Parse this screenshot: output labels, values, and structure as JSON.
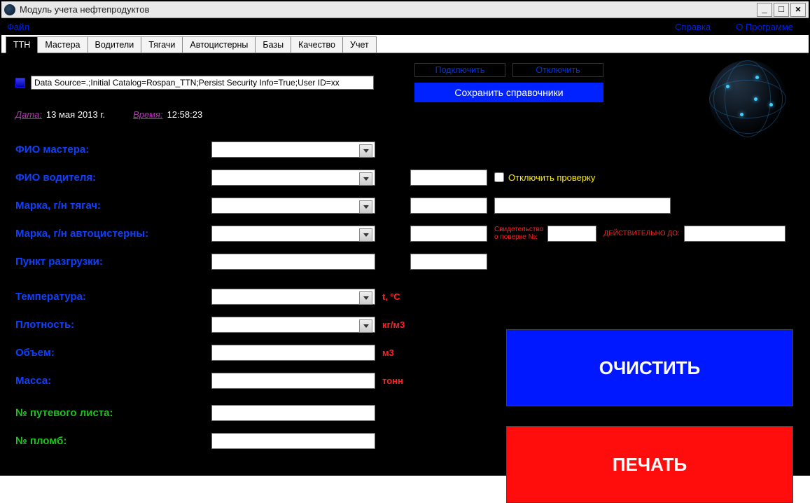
{
  "window": {
    "title": "Модуль учета нефтепродуктов"
  },
  "menu": {
    "file": "Файл",
    "help": "Справка",
    "about": "О Программе"
  },
  "tabs": [
    "ТТН",
    "Мастера",
    "Водители",
    "Тягачи",
    "Автоцистерны",
    "Базы",
    "Качество",
    "Учет"
  ],
  "conn": {
    "source": "Data Source=.;Initial Catalog=Rospan_TTN;Persist Security Info=True;User ID=xx",
    "connect": "Подключить",
    "disconnect": "Отключить",
    "save_ref": "Сохранить справочники"
  },
  "datetime": {
    "date_label": "Дата:",
    "date_value": "13 мая 2013 г.",
    "time_label": "Время:",
    "time_value": "12:58:23"
  },
  "labels": {
    "master": "ФИО мастера:",
    "driver": "ФИО водителя:",
    "tractor": "Марка, г/н тягач:",
    "tanker": "Марка, г/н автоцистерны:",
    "unload": "Пункт  разгрузки:",
    "temp": "Температура:",
    "density": "Плотность:",
    "volume": "Объем:",
    "mass": "Масса:",
    "waybill": "№ путевого листа:",
    "seals": "№ пломб:"
  },
  "aux": {
    "disable_check": "Отключить проверку",
    "svidetelstvo": "Свидетельство\nо поверке №:",
    "valid_until": "ДЕЙСТВИТЕЛЬНО ДО:"
  },
  "units": {
    "temp": "t, ºC",
    "density": "кг/м3",
    "volume": "м3",
    "mass": "тонн"
  },
  "buttons": {
    "clear": "ОЧИСТИТЬ",
    "print": "ПЕЧАТЬ"
  }
}
